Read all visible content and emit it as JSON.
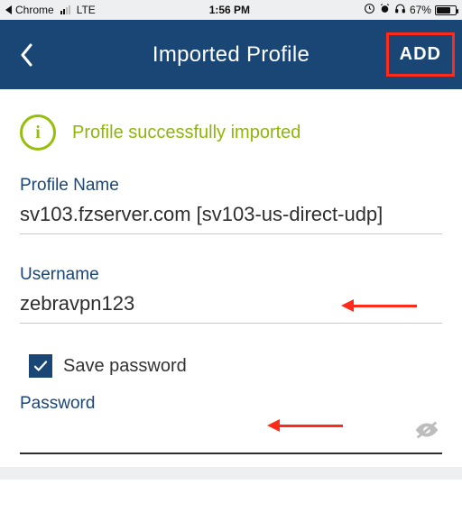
{
  "status": {
    "back_app": "Chrome",
    "carrier": "LTE",
    "time": "1:56 PM",
    "battery_pct": "67%",
    "battery_fill": 67
  },
  "nav": {
    "title": "Imported Profile",
    "add_label": "ADD"
  },
  "success": {
    "icon_glyph": "i",
    "message": "Profile successfully imported"
  },
  "fields": {
    "profile_name": {
      "label": "Profile Name",
      "value": "sv103.fzserver.com [sv103-us-direct-udp]"
    },
    "username": {
      "label": "Username",
      "value": "zebravpn123"
    },
    "save_password": {
      "checked": true,
      "label": "Save password"
    },
    "password": {
      "label": "Password",
      "value": ""
    }
  }
}
